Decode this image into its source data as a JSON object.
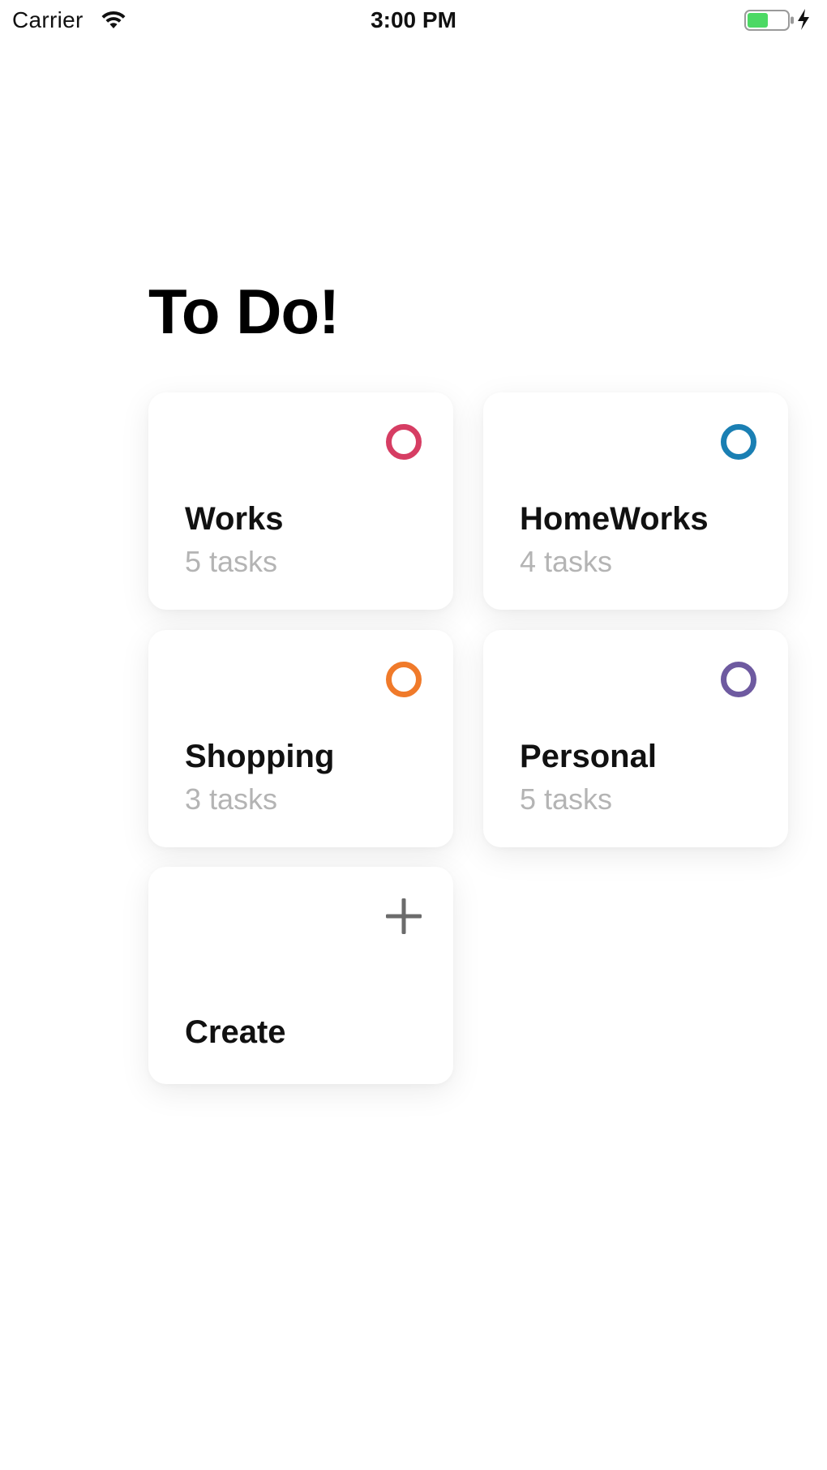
{
  "status_bar": {
    "carrier": "Carrier",
    "time": "3:00 PM",
    "wifi_icon": "wifi-icon",
    "battery_icon": "battery-charging-icon",
    "battery_color": "#4cd964"
  },
  "header": {
    "title": "To Do!"
  },
  "categories": [
    {
      "title": "Works",
      "subtitle": "5 tasks",
      "color": "#d63d63",
      "icon": "ring-icon"
    },
    {
      "title": "HomeWorks",
      "subtitle": "4 tasks",
      "color": "#1a7fb3",
      "icon": "ring-icon"
    },
    {
      "title": "Shopping",
      "subtitle": "3 tasks",
      "color": "#f07a2a",
      "icon": "ring-icon"
    },
    {
      "title": "Personal",
      "subtitle": "5 tasks",
      "color": "#6e5aa0",
      "icon": "ring-icon"
    }
  ],
  "create": {
    "label": "Create",
    "icon": "plus-icon",
    "icon_color": "#6b6b6b"
  }
}
